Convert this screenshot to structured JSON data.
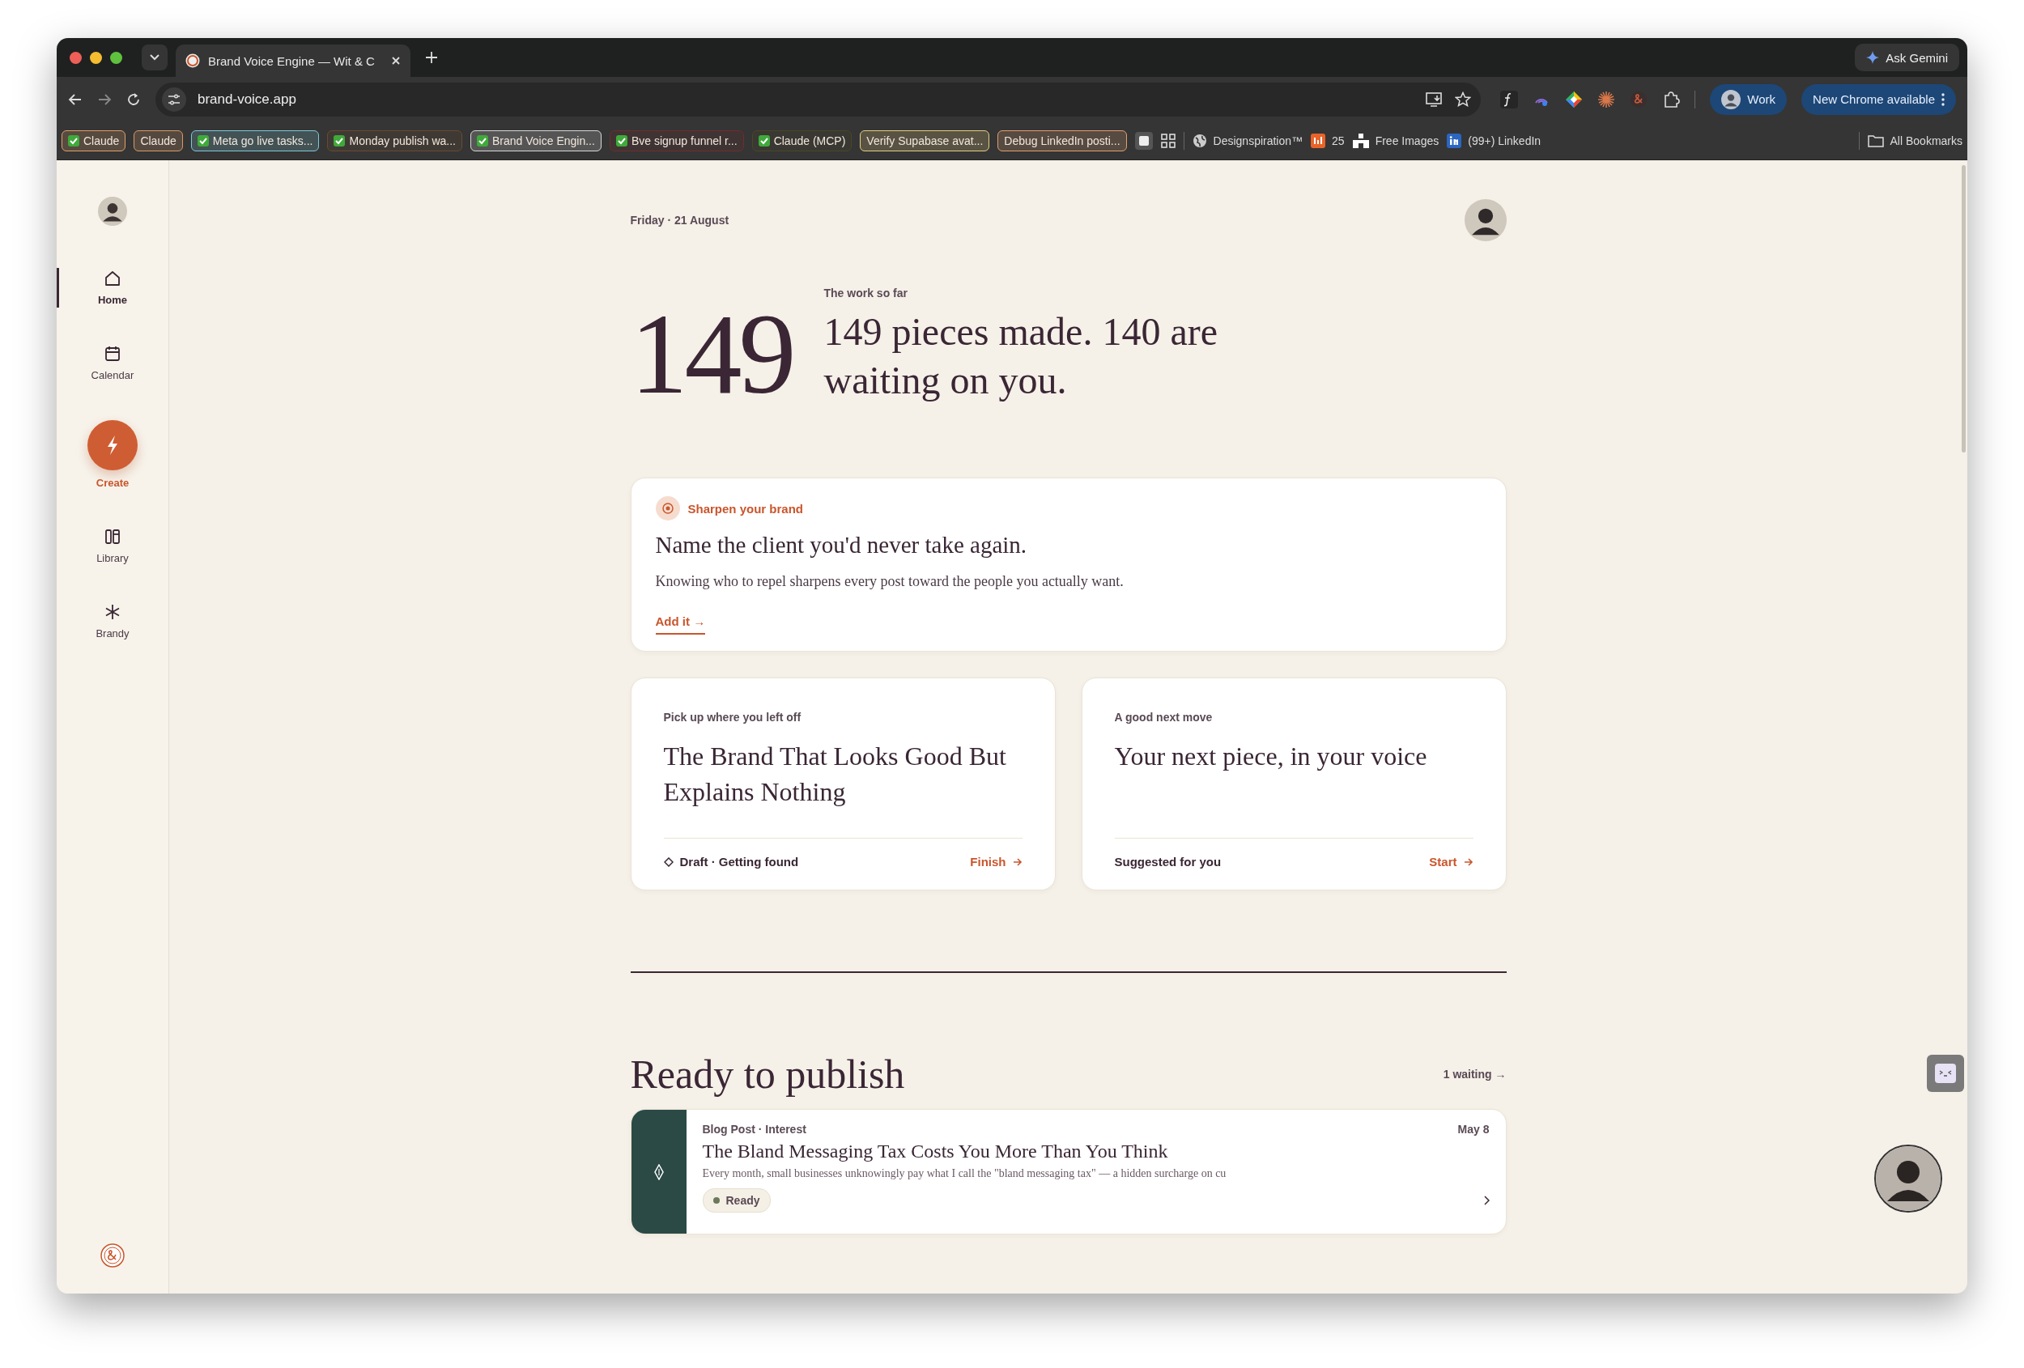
{
  "browser": {
    "tab": {
      "title": "Brand Voice Engine — Wit & C"
    },
    "url": "brand-voice.app",
    "ask_button": "Ask Gemini",
    "profile_button": "Work",
    "update_button": "New Chrome available",
    "bookmarks": [
      {
        "kind": "chip",
        "label": "Claude",
        "checked": true,
        "color": "#e0a06a"
      },
      {
        "kind": "chip",
        "label": "Claude",
        "checked": false,
        "color": "#d69a6a"
      },
      {
        "kind": "chip",
        "label": "Meta go live tasks...",
        "checked": true,
        "color": "#7ccad6"
      },
      {
        "kind": "chip",
        "label": "Monday publish wa...",
        "checked": true,
        "color": "#6a4b31"
      },
      {
        "kind": "chip",
        "label": "Brand Voice Engin...",
        "checked": true,
        "color": "#d8d8d8"
      },
      {
        "kind": "chip",
        "label": "Bve signup funnel r...",
        "checked": true,
        "color": "#6e2e2e"
      },
      {
        "kind": "chip",
        "label": "Claude (MCP)",
        "checked": true,
        "color": "#4a4826"
      },
      {
        "kind": "chip",
        "label": "Verify Supabase avat...",
        "checked": false,
        "color": "#e6cf7e"
      },
      {
        "kind": "chip",
        "label": "Debug LinkedIn posti...",
        "checked": false,
        "color": "#e0a070"
      },
      {
        "kind": "square"
      },
      {
        "kind": "grid"
      },
      {
        "kind": "globe",
        "label": "Designspiration™"
      },
      {
        "kind": "counter",
        "label": "25"
      },
      {
        "kind": "images",
        "label": "Free Images"
      },
      {
        "kind": "linkedin",
        "label": "(99+) LinkedIn"
      }
    ],
    "all_bookmarks": "All Bookmarks"
  },
  "sidebar": {
    "items": [
      {
        "kind": "home",
        "label": "Home",
        "selected": true
      },
      {
        "kind": "calendar",
        "label": "Calendar",
        "selected": false
      },
      {
        "kind": "create",
        "label": "Create",
        "selected": false
      },
      {
        "kind": "library",
        "label": "Library",
        "selected": false
      },
      {
        "kind": "brandy",
        "label": "Brandy",
        "selected": false
      }
    ]
  },
  "header": {
    "date": "Friday · 21 August"
  },
  "stat": {
    "label": "The work so far",
    "number": "149",
    "headline": "149 pieces made. 140 are waiting on you."
  },
  "prompt_card": {
    "tag": "Sharpen your brand",
    "title": "Name the client you'd never take again.",
    "body": "Knowing who to repel sharpens every post toward the people you actually want.",
    "link": "Add it →"
  },
  "cards": [
    {
      "kind": "draft",
      "eyebrow": "Pick up where you left off",
      "title": "The Brand That Looks Good But Explains Nothing",
      "meta": "Draft · Getting found",
      "action": "Finish"
    },
    {
      "kind": "suggestion",
      "eyebrow": "A good next move",
      "title": "Your next piece, in your voice",
      "meta": "Suggested for you",
      "action": "Start"
    }
  ],
  "publish": {
    "title": "Ready to publish",
    "link": "1 waiting →",
    "items": [
      {
        "meta": "Blog Post · Interest",
        "date": "May 8",
        "title": "The Bland Messaging Tax Costs You More Than You Think",
        "excerpt": "Every month, small businesses unknowingly pay what I call the \"bland messaging tax\" — a hidden surcharge on cu",
        "status": "Ready"
      }
    ]
  }
}
